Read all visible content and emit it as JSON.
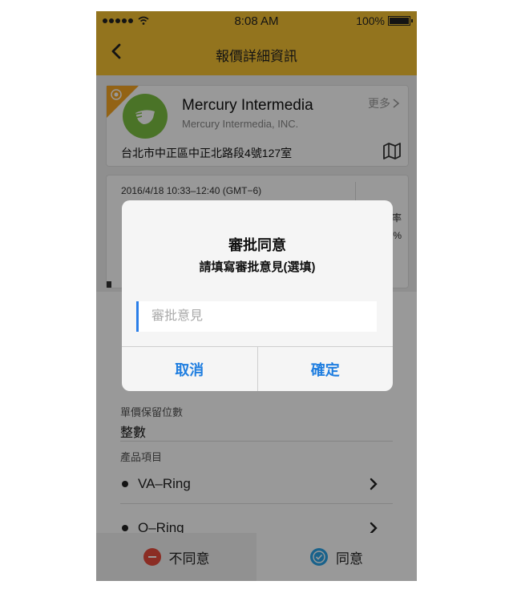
{
  "status_bar": {
    "time": "8:08 AM",
    "battery": "100%"
  },
  "nav": {
    "title": "報價詳細資訊"
  },
  "company": {
    "name": "Mercury Intermedia",
    "subtitle": "Mercury Intermedia, INC.",
    "more_label": "更多",
    "address": "台北市中正區中正北路段4號127室"
  },
  "schedule": {
    "time_range": "2016/4/18 10:33–12:40 (GMT−6)",
    "side_text_1": "率",
    "side_text_2": "%"
  },
  "fields": {
    "decimal_label": "單價保留位數",
    "decimal_value": "整數",
    "products_label": "產品項目",
    "products": [
      "VA–Ring",
      "O–Ring"
    ]
  },
  "bottom_bar": {
    "reject_label": "不同意",
    "approve_label": "同意"
  },
  "dialog": {
    "title": "審批同意",
    "subtitle": "請填寫審批意見(選填)",
    "input_placeholder": "審批意見",
    "cancel_label": "取消",
    "confirm_label": "確定"
  },
  "colors": {
    "header": "#f5c132",
    "accent_blue": "#1f7ee0",
    "reject_red": "#e84c3d",
    "approve_blue": "#2aa4e8",
    "logo_green": "#7cc042",
    "ribbon_orange": "#f5a623"
  }
}
